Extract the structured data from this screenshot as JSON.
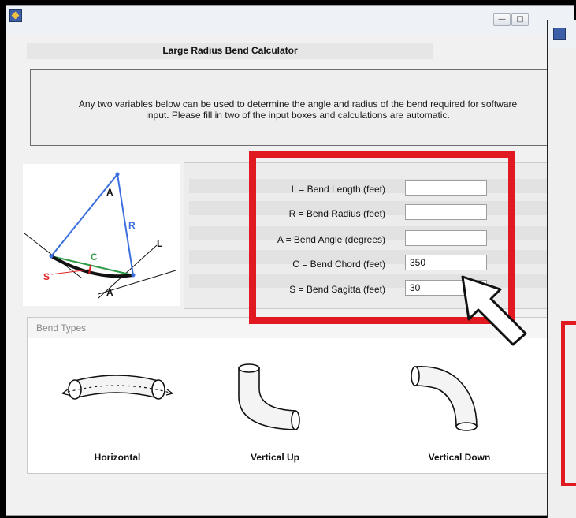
{
  "window": {
    "app_icon": "app-icon",
    "controls": {
      "minimize": "—",
      "maximize": "□"
    }
  },
  "calculator": {
    "heading": "Large Radius Bend Calculator",
    "instructions_line1": "Any two variables below can be used to determine the angle and radius of the bend required for software",
    "instructions_line2": "input.  Please fill in two of the input boxes and calculations are automatic."
  },
  "diagram": {
    "labels": {
      "a_top": "A",
      "r": "R",
      "c": "C",
      "s": "S",
      "l": "L",
      "a_bottom": "A"
    },
    "colors": {
      "radius_lines": "#3b6fe0",
      "chord": "#2e9b46",
      "sagitta": "#e02020",
      "bend": "#111111"
    }
  },
  "inputs": {
    "length_label": "L = Bend Length  (feet)",
    "length_value": "",
    "radius_label": "R = Bend Radius  (feet)",
    "radius_value": "",
    "angle_label": "A = Bend Angle  (degrees)",
    "angle_value": "",
    "chord_label": "C = Bend Chord  (feet)",
    "chord_value": "350",
    "sagitta_label": "S = Bend Sagitta  (feet)",
    "sagitta_value": "30"
  },
  "annotation": {
    "highlight_color": "#e11a22",
    "pointer": "arrow-pointer-icon"
  },
  "bend_types": {
    "title": "Bend Types",
    "horizontal": "Horizontal",
    "vertical_up": "Vertical Up",
    "vertical_down": "Vertical Down"
  }
}
